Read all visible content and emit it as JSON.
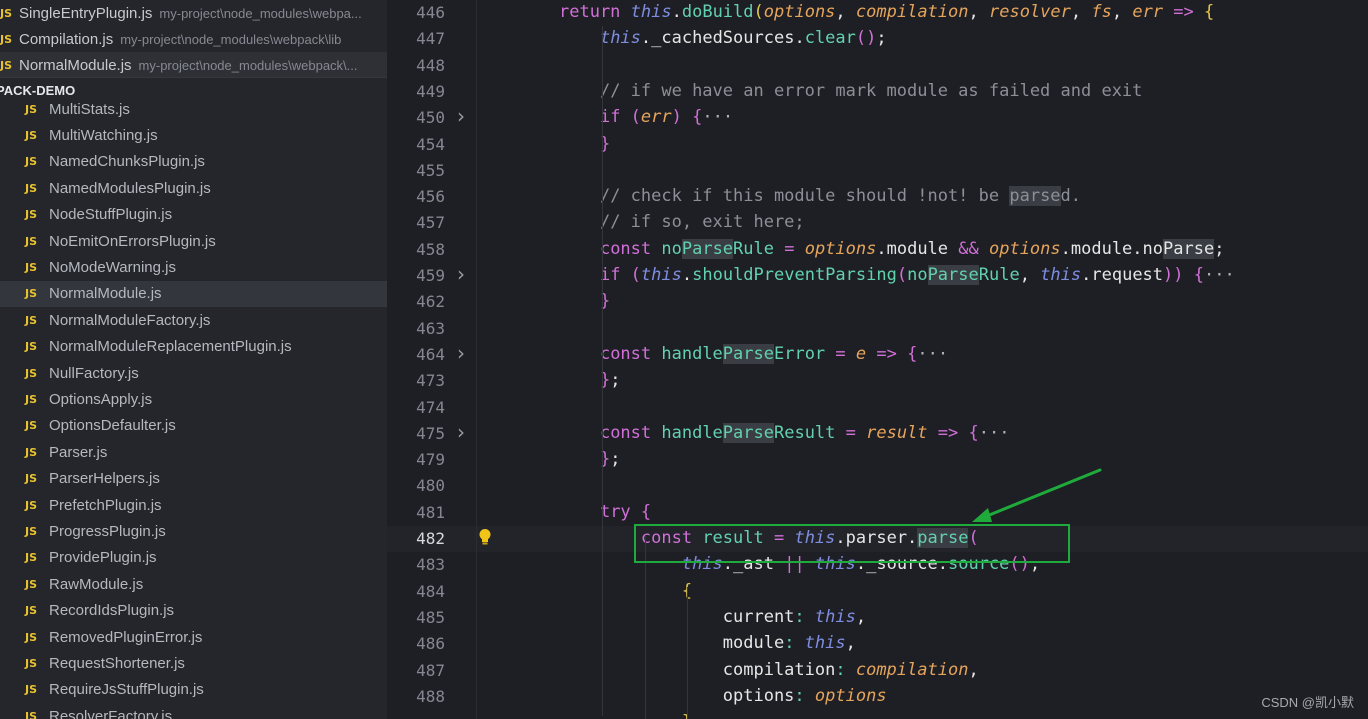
{
  "sidebar": {
    "open_editors": [
      {
        "badge": "JS",
        "name": "SingleEntryPlugin.js",
        "path": "my-project\\node_modules\\webpa..."
      },
      {
        "badge": "JS",
        "name": "Compilation.js",
        "path": "my-project\\node_modules\\webpack\\lib"
      },
      {
        "badge": "JS",
        "name": "NormalModule.js",
        "path": "my-project\\node_modules\\webpack\\..."
      }
    ],
    "section_title": "PACK-DEMO",
    "files": [
      {
        "badge": "JS",
        "name": "MultiStats.js"
      },
      {
        "badge": "JS",
        "name": "MultiWatching.js"
      },
      {
        "badge": "JS",
        "name": "NamedChunksPlugin.js"
      },
      {
        "badge": "JS",
        "name": "NamedModulesPlugin.js"
      },
      {
        "badge": "JS",
        "name": "NodeStuffPlugin.js"
      },
      {
        "badge": "JS",
        "name": "NoEmitOnErrorsPlugin.js"
      },
      {
        "badge": "JS",
        "name": "NoModeWarning.js"
      },
      {
        "badge": "JS",
        "name": "NormalModule.js",
        "selected": true
      },
      {
        "badge": "JS",
        "name": "NormalModuleFactory.js"
      },
      {
        "badge": "JS",
        "name": "NormalModuleReplacementPlugin.js"
      },
      {
        "badge": "JS",
        "name": "NullFactory.js"
      },
      {
        "badge": "JS",
        "name": "OptionsApply.js"
      },
      {
        "badge": "JS",
        "name": "OptionsDefaulter.js"
      },
      {
        "badge": "JS",
        "name": "Parser.js"
      },
      {
        "badge": "JS",
        "name": "ParserHelpers.js"
      },
      {
        "badge": "JS",
        "name": "PrefetchPlugin.js"
      },
      {
        "badge": "JS",
        "name": "ProgressPlugin.js"
      },
      {
        "badge": "JS",
        "name": "ProvidePlugin.js"
      },
      {
        "badge": "JS",
        "name": "RawModule.js"
      },
      {
        "badge": "JS",
        "name": "RecordIdsPlugin.js"
      },
      {
        "badge": "JS",
        "name": "RemovedPluginError.js"
      },
      {
        "badge": "JS",
        "name": "RequestShortener.js"
      },
      {
        "badge": "JS",
        "name": "RequireJsStuffPlugin.js"
      },
      {
        "badge": "JS",
        "name": "ResolverFactory.js"
      }
    ]
  },
  "editor": {
    "lines": [
      {
        "num": "446",
        "fold": false,
        "indent": "",
        "tokens": [
          [
            "kw",
            "return "
          ],
          [
            "th",
            "this"
          ],
          [
            "pl",
            "."
          ],
          [
            "fn",
            "doBuild"
          ],
          [
            "br",
            "("
          ],
          [
            "pr",
            "options"
          ],
          [
            "pl",
            ", "
          ],
          [
            "pr",
            "compilation"
          ],
          [
            "pl",
            ", "
          ],
          [
            "pr",
            "resolver"
          ],
          [
            "pl",
            ", "
          ],
          [
            "pr",
            "fs"
          ],
          [
            "pl",
            ", "
          ],
          [
            "pr",
            "err"
          ],
          [
            "kw",
            " => "
          ],
          [
            "br",
            "{"
          ]
        ]
      },
      {
        "num": "447",
        "fold": false,
        "indent": "    ",
        "tokens": [
          [
            "th",
            "this"
          ],
          [
            "pl",
            "."
          ],
          [
            "pl",
            "_cachedSources"
          ],
          [
            "pl",
            "."
          ],
          [
            "fn",
            "clear"
          ],
          [
            "kw",
            "()"
          ],
          [
            "pl",
            ";"
          ]
        ]
      },
      {
        "num": "448",
        "fold": false,
        "indent": "",
        "tokens": []
      },
      {
        "num": "449",
        "fold": false,
        "indent": "    ",
        "tokens": [
          [
            "cm",
            "// if we have an error mark module as failed and exit"
          ]
        ]
      },
      {
        "num": "450",
        "fold": true,
        "indent": "    ",
        "tokens": [
          [
            "kw",
            "if "
          ],
          [
            "kw",
            "("
          ],
          [
            "pr",
            "err"
          ],
          [
            "kw",
            ") "
          ],
          [
            "kw",
            "{"
          ],
          [
            "ell",
            "···"
          ]
        ]
      },
      {
        "num": "454",
        "fold": false,
        "indent": "    ",
        "tokens": [
          [
            "kw",
            "}"
          ]
        ]
      },
      {
        "num": "455",
        "fold": false,
        "indent": "",
        "tokens": []
      },
      {
        "num": "456",
        "fold": false,
        "indent": "    ",
        "tokens": [
          [
            "cm",
            "// check if this module should !not! be "
          ],
          [
            "cm hl",
            "parse"
          ],
          [
            "cm",
            "d."
          ]
        ]
      },
      {
        "num": "457",
        "fold": false,
        "indent": "    ",
        "tokens": [
          [
            "cm",
            "// if so, exit here;"
          ]
        ]
      },
      {
        "num": "458",
        "fold": false,
        "indent": "    ",
        "tokens": [
          [
            "kw",
            "const "
          ],
          [
            "fn",
            "no"
          ],
          [
            "fn hl",
            "Parse"
          ],
          [
            "fn",
            "Rule"
          ],
          [
            "kw",
            " = "
          ],
          [
            "pr",
            "options"
          ],
          [
            "pl",
            ".module "
          ],
          [
            "kw",
            "&& "
          ],
          [
            "pr",
            "options"
          ],
          [
            "pl",
            ".module.no"
          ],
          [
            "pl hl",
            "Parse"
          ],
          [
            "pl",
            ";"
          ]
        ]
      },
      {
        "num": "459",
        "fold": true,
        "indent": "    ",
        "tokens": [
          [
            "kw",
            "if "
          ],
          [
            "kw",
            "("
          ],
          [
            "th",
            "this"
          ],
          [
            "pl",
            "."
          ],
          [
            "fn",
            "shouldPreventParsing"
          ],
          [
            "kw",
            "("
          ],
          [
            "fn",
            "no"
          ],
          [
            "fn hl",
            "Parse"
          ],
          [
            "fn",
            "Rule"
          ],
          [
            "pl",
            ", "
          ],
          [
            "th",
            "this"
          ],
          [
            "pl",
            ".request"
          ],
          [
            "kw",
            ")) "
          ],
          [
            "kw",
            "{"
          ],
          [
            "ell",
            "···"
          ]
        ]
      },
      {
        "num": "462",
        "fold": false,
        "indent": "    ",
        "tokens": [
          [
            "kw",
            "}"
          ]
        ]
      },
      {
        "num": "463",
        "fold": false,
        "indent": "",
        "tokens": []
      },
      {
        "num": "464",
        "fold": true,
        "indent": "    ",
        "tokens": [
          [
            "kw",
            "const "
          ],
          [
            "fn",
            "handle"
          ],
          [
            "fn hl",
            "Parse"
          ],
          [
            "fn",
            "Error"
          ],
          [
            "kw",
            " = "
          ],
          [
            "pr",
            "e"
          ],
          [
            "kw",
            " => "
          ],
          [
            "kw",
            "{"
          ],
          [
            "ell",
            "···"
          ]
        ]
      },
      {
        "num": "473",
        "fold": false,
        "indent": "    ",
        "tokens": [
          [
            "kw",
            "}"
          ],
          [
            "pl",
            ";"
          ]
        ]
      },
      {
        "num": "474",
        "fold": false,
        "indent": "",
        "tokens": []
      },
      {
        "num": "475",
        "fold": true,
        "indent": "    ",
        "tokens": [
          [
            "kw",
            "const "
          ],
          [
            "fn",
            "handle"
          ],
          [
            "fn hl",
            "Parse"
          ],
          [
            "fn",
            "Result"
          ],
          [
            "kw",
            " = "
          ],
          [
            "pr",
            "result"
          ],
          [
            "kw",
            " => "
          ],
          [
            "kw",
            "{"
          ],
          [
            "ell",
            "···"
          ]
        ]
      },
      {
        "num": "479",
        "fold": false,
        "indent": "    ",
        "tokens": [
          [
            "kw",
            "}"
          ],
          [
            "pl",
            ";"
          ]
        ]
      },
      {
        "num": "480",
        "fold": false,
        "indent": "",
        "tokens": []
      },
      {
        "num": "481",
        "fold": false,
        "indent": "    ",
        "tokens": [
          [
            "kw",
            "try "
          ],
          [
            "kw",
            "{"
          ]
        ]
      },
      {
        "num": "482",
        "fold": false,
        "current": true,
        "indent": "        ",
        "tokens": [
          [
            "kw",
            "const "
          ],
          [
            "fn",
            "result"
          ],
          [
            "kw",
            " = "
          ],
          [
            "th",
            "this"
          ],
          [
            "pl",
            ".parser."
          ],
          [
            "fn hl",
            "parse"
          ],
          [
            "kw",
            "("
          ]
        ]
      },
      {
        "num": "483",
        "fold": false,
        "indent": "            ",
        "tokens": [
          [
            "th",
            "this"
          ],
          [
            "pl",
            "._ast "
          ],
          [
            "kw",
            "|| "
          ],
          [
            "th",
            "this"
          ],
          [
            "pl",
            "._source."
          ],
          [
            "fn",
            "source"
          ],
          [
            "kw",
            "()"
          ],
          [
            "pl",
            ","
          ]
        ]
      },
      {
        "num": "484",
        "fold": false,
        "indent": "            ",
        "tokens": [
          [
            "br",
            "{"
          ]
        ]
      },
      {
        "num": "485",
        "fold": false,
        "indent": "                ",
        "tokens": [
          [
            "pl",
            "current"
          ],
          [
            "fn",
            ": "
          ],
          [
            "th",
            "this"
          ],
          [
            "pl",
            ","
          ]
        ]
      },
      {
        "num": "486",
        "fold": false,
        "indent": "                ",
        "tokens": [
          [
            "pl",
            "module"
          ],
          [
            "fn",
            ": "
          ],
          [
            "th",
            "this"
          ],
          [
            "pl",
            ","
          ]
        ]
      },
      {
        "num": "487",
        "fold": false,
        "indent": "                ",
        "tokens": [
          [
            "pl",
            "compilation"
          ],
          [
            "fn",
            ": "
          ],
          [
            "pr",
            "compilation"
          ],
          [
            "pl",
            ","
          ]
        ]
      },
      {
        "num": "488",
        "fold": false,
        "indent": "                ",
        "tokens": [
          [
            "pl",
            "options"
          ],
          [
            "fn",
            ": "
          ],
          [
            "pr",
            "options"
          ]
        ]
      },
      {
        "num": "",
        "fold": false,
        "indent": "            ",
        "tokens": [
          [
            "br",
            "}"
          ]
        ]
      }
    ]
  },
  "watermark": "CSDN @凯小默",
  "colors": {
    "annotation": "#1faa3c",
    "js_badge": "#e8c230",
    "keyword": "#d170d8",
    "function": "#62d1ae",
    "param": "#e5a45b"
  }
}
